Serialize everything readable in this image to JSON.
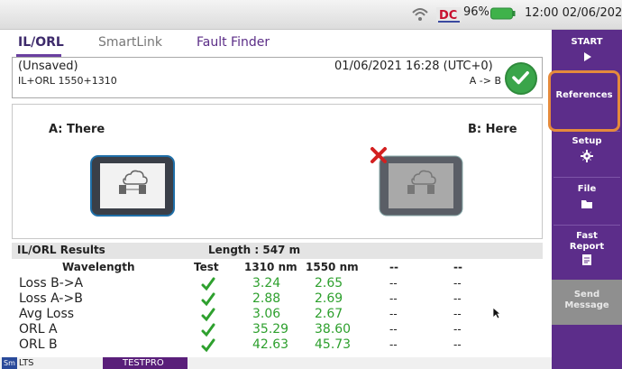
{
  "status": {
    "battery_pct": "96%",
    "clock": "12:00 02/06/2021"
  },
  "tabs": {
    "il_orl": "IL/ORL",
    "smartlink": "SmartLink",
    "fault_finder": "Fault Finder"
  },
  "info": {
    "name": "(Unsaved)",
    "subtitle": "IL+ORL 1550+1310",
    "datetime": "01/06/2021 16:28 (UTC+0)",
    "direction": "A -> B"
  },
  "diagram": {
    "label_a": "A: There",
    "label_b": "B: Here"
  },
  "results": {
    "title": "IL/ORL Results",
    "length": "Length : 547 m",
    "columns": [
      "Wavelength",
      "Test",
      "1310 nm",
      "1550 nm",
      "--",
      "--"
    ],
    "rows": [
      {
        "label": "Loss B->A",
        "v1310": "3.24",
        "v1550": "2.65",
        "d1": "--",
        "d2": "--"
      },
      {
        "label": "Loss A->B",
        "v1310": "2.88",
        "v1550": "2.69",
        "d1": "--",
        "d2": "--"
      },
      {
        "label": "Avg Loss",
        "v1310": "3.06",
        "v1550": "2.67",
        "d1": "--",
        "d2": "--"
      },
      {
        "label": "ORL A",
        "v1310": "35.29",
        "v1550": "38.60",
        "d1": "--",
        "d2": "--"
      },
      {
        "label": "ORL B",
        "v1310": "42.63",
        "v1550": "45.73",
        "d1": "--",
        "d2": "--"
      }
    ]
  },
  "bottom": {
    "lts": "LTS",
    "lts_badge": "Sm",
    "testpro": "TESTPRO"
  },
  "sidebar": {
    "start": "START",
    "references": "References",
    "setup": "Setup",
    "file": "File",
    "fast_report": "Fast Report",
    "send_message": "Send Message"
  },
  "colors": {
    "sidebar": "#5c2d8a",
    "highlight": "#e58a3c",
    "value_green": "#2ea02e",
    "ok_green": "#3aa54a"
  }
}
